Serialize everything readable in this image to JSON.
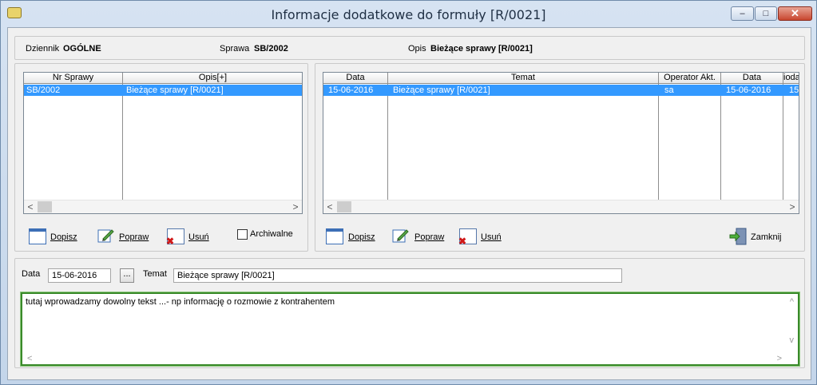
{
  "window": {
    "title": "Informacje dodatkowe do formuły [R/0021]"
  },
  "title_buttons": {
    "minimize": "–",
    "maximize": "□",
    "close": "✕"
  },
  "info": {
    "dziennik_label": "Dziennik",
    "dziennik_value": "OGÓLNE",
    "sprawa_label": "Sprawa",
    "sprawa_value": "SB/2002",
    "opis_label": "Opis",
    "opis_value": "Bieżące sprawy [R/0021]"
  },
  "left_grid": {
    "headers": [
      "Nr Sprawy",
      "Opis[+]"
    ],
    "rows": [
      [
        "SB/2002",
        "Bieżące sprawy [R/0021]"
      ]
    ]
  },
  "right_grid": {
    "headers": [
      "Data",
      "Temat",
      "Operator Akt.",
      "Data",
      "ioda"
    ],
    "rows": [
      [
        "15-06-2016",
        "Bieżące sprawy [R/0021]",
        "sa",
        "15-06-2016",
        "15"
      ]
    ]
  },
  "left_buttons": {
    "dopisz": "Dopisz",
    "popraw": "Popraw",
    "usun": "Usuń",
    "archiwalne": "Archiwalne"
  },
  "right_buttons": {
    "dopisz": "Dopisz",
    "popraw": "Popraw",
    "usun": "Usuń",
    "zamknij": "Zamknij"
  },
  "detail": {
    "data_label": "Data",
    "data_value": "15-06-2016",
    "dots": "...",
    "temat_label": "Temat",
    "temat_value": "Bieżące sprawy [R/0021]",
    "memo_text": "tutaj wprowadzamy dowolny tekst ...- np informację o rozmowie z kontrahentem"
  },
  "scroll": {
    "left": "<",
    "right": ">",
    "up": "^",
    "down": "v"
  },
  "colors": {
    "selection": "#3399ff",
    "memo_border": "#3a8a2a"
  }
}
